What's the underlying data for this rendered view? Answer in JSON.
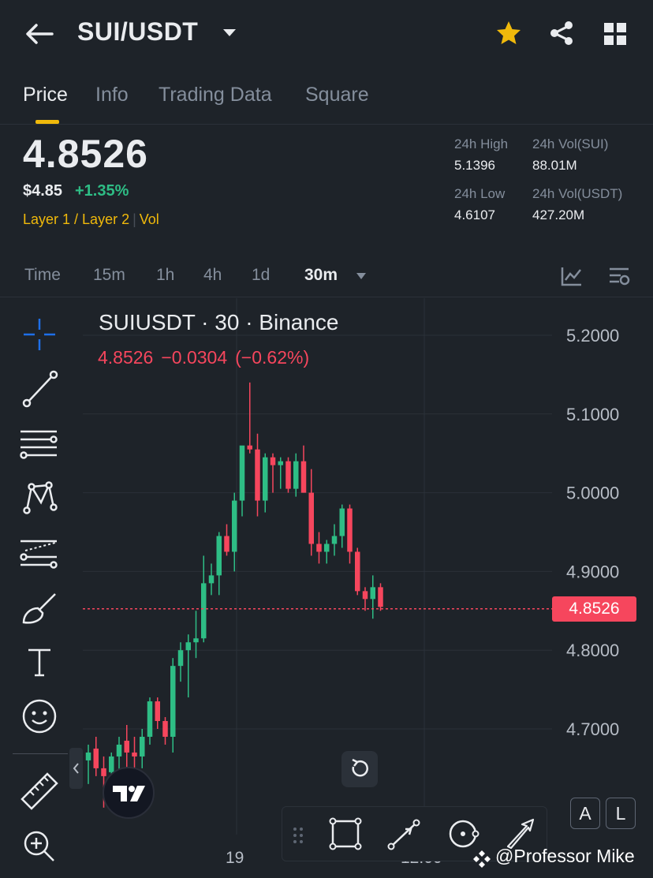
{
  "header": {
    "pair": "SUI/USDT",
    "icons": [
      "back-arrow-icon",
      "caret-down-icon",
      "star-icon",
      "share-icon",
      "grid-icon"
    ],
    "star_color": "#f0b90b"
  },
  "tabs": [
    {
      "label": "Price",
      "active": true
    },
    {
      "label": "Info",
      "active": false
    },
    {
      "label": "Trading Data",
      "active": false
    },
    {
      "label": "Square",
      "active": false
    }
  ],
  "ticker": {
    "last_price": "4.8526",
    "usd_price": "$4.85",
    "change_pct": "+1.35%",
    "tag1": "Layer 1 / Layer 2",
    "tag2": "Vol",
    "stats": {
      "high_label": "24h High",
      "high_value": "5.1396",
      "vol_sui_label": "24h Vol(SUI)",
      "vol_sui_value": "88.01M",
      "low_label": "24h Low",
      "low_value": "4.6107",
      "vol_usdt_label": "24h Vol(USDT)",
      "vol_usdt_value": "427.20M"
    }
  },
  "intervals": [
    {
      "label": "Time",
      "active": false
    },
    {
      "label": "15m",
      "active": false
    },
    {
      "label": "1h",
      "active": false
    },
    {
      "label": "4h",
      "active": false
    },
    {
      "label": "1d",
      "active": false
    },
    {
      "label": "30m",
      "active": true
    }
  ],
  "chart_header": {
    "title": "SUIUSDT · 30 · Binance",
    "last": "4.8526",
    "change": "−0.0304",
    "change_pct": "(−0.62%)"
  },
  "draw_tools": [
    "crosshair-icon",
    "trend-line-icon",
    "fib-lines-icon",
    "pattern-icon",
    "parallel-channel-icon",
    "brush-icon",
    "text-icon",
    "emoji-icon",
    "ruler-icon",
    "zoom-in-icon"
  ],
  "scale_buttons": {
    "auto": "A",
    "log": "L"
  },
  "watermark": "@Professor Mike",
  "colors": {
    "up": "#2ebd85",
    "down": "#f6465d",
    "accent": "#f0b90b",
    "bg": "#1e2329"
  },
  "chart_data": {
    "type": "candlestick",
    "title": "SUIUSDT · 30 · Binance",
    "y_ticks": [
      "5.2000",
      "5.1000",
      "5.0000",
      "4.9000",
      "4.8000",
      "4.7000"
    ],
    "ylim": [
      4.6,
      5.22
    ],
    "x_labels": [
      "19",
      "12:00"
    ],
    "last_price_label": "4.8526",
    "last_price": 4.8526,
    "grid": true,
    "candles": [
      {
        "o": 4.66,
        "h": 4.68,
        "l": 4.63,
        "c": 4.67
      },
      {
        "o": 4.675,
        "h": 4.69,
        "l": 4.64,
        "c": 4.65
      },
      {
        "o": 4.65,
        "h": 4.665,
        "l": 4.6,
        "c": 4.64
      },
      {
        "o": 4.645,
        "h": 4.67,
        "l": 4.62,
        "c": 4.665
      },
      {
        "o": 4.665,
        "h": 4.69,
        "l": 4.64,
        "c": 4.68
      },
      {
        "o": 4.685,
        "h": 4.705,
        "l": 4.65,
        "c": 4.67
      },
      {
        "o": 4.67,
        "h": 4.69,
        "l": 4.64,
        "c": 4.665
      },
      {
        "o": 4.665,
        "h": 4.7,
        "l": 4.65,
        "c": 4.69
      },
      {
        "o": 4.69,
        "h": 4.74,
        "l": 4.68,
        "c": 4.735
      },
      {
        "o": 4.735,
        "h": 4.74,
        "l": 4.7,
        "c": 4.71
      },
      {
        "o": 4.71,
        "h": 4.715,
        "l": 4.68,
        "c": 4.69
      },
      {
        "o": 4.69,
        "h": 4.79,
        "l": 4.67,
        "c": 4.78
      },
      {
        "o": 4.78,
        "h": 4.81,
        "l": 4.76,
        "c": 4.8
      },
      {
        "o": 4.8,
        "h": 4.82,
        "l": 4.74,
        "c": 4.81
      },
      {
        "o": 4.81,
        "h": 4.85,
        "l": 4.79,
        "c": 4.815
      },
      {
        "o": 4.815,
        "h": 4.92,
        "l": 4.81,
        "c": 4.885
      },
      {
        "o": 4.885,
        "h": 4.91,
        "l": 4.87,
        "c": 4.895
      },
      {
        "o": 4.895,
        "h": 4.95,
        "l": 4.87,
        "c": 4.945
      },
      {
        "o": 4.945,
        "h": 4.96,
        "l": 4.92,
        "c": 4.925
      },
      {
        "o": 4.925,
        "h": 5.0,
        "l": 4.9,
        "c": 4.99
      },
      {
        "o": 4.99,
        "h": 5.02,
        "l": 4.97,
        "c": 5.06
      },
      {
        "o": 5.06,
        "h": 5.14,
        "l": 5.05,
        "c": 5.055
      },
      {
        "o": 5.055,
        "h": 5.075,
        "l": 4.97,
        "c": 4.99
      },
      {
        "o": 4.99,
        "h": 5.05,
        "l": 4.975,
        "c": 5.045
      },
      {
        "o": 5.045,
        "h": 5.05,
        "l": 5.0,
        "c": 5.035
      },
      {
        "o": 5.035,
        "h": 5.045,
        "l": 5.005,
        "c": 5.04
      },
      {
        "o": 5.04,
        "h": 5.045,
        "l": 5.0,
        "c": 5.005
      },
      {
        "o": 5.005,
        "h": 5.05,
        "l": 4.995,
        "c": 5.04
      },
      {
        "o": 5.04,
        "h": 5.06,
        "l": 5.0,
        "c": 5.0
      },
      {
        "o": 5.0,
        "h": 5.03,
        "l": 4.92,
        "c": 4.935
      },
      {
        "o": 4.935,
        "h": 4.95,
        "l": 4.91,
        "c": 4.925
      },
      {
        "o": 4.925,
        "h": 4.94,
        "l": 4.91,
        "c": 4.935
      },
      {
        "o": 4.935,
        "h": 4.96,
        "l": 4.92,
        "c": 4.945
      },
      {
        "o": 4.945,
        "h": 4.985,
        "l": 4.93,
        "c": 4.98
      },
      {
        "o": 4.98,
        "h": 4.985,
        "l": 4.91,
        "c": 4.925
      },
      {
        "o": 4.925,
        "h": 4.93,
        "l": 4.87,
        "c": 4.875
      },
      {
        "o": 4.875,
        "h": 4.88,
        "l": 4.85,
        "c": 4.865
      },
      {
        "o": 4.865,
        "h": 4.895,
        "l": 4.84,
        "c": 4.88
      },
      {
        "o": 4.88,
        "h": 4.885,
        "l": 4.85,
        "c": 4.855
      }
    ]
  }
}
